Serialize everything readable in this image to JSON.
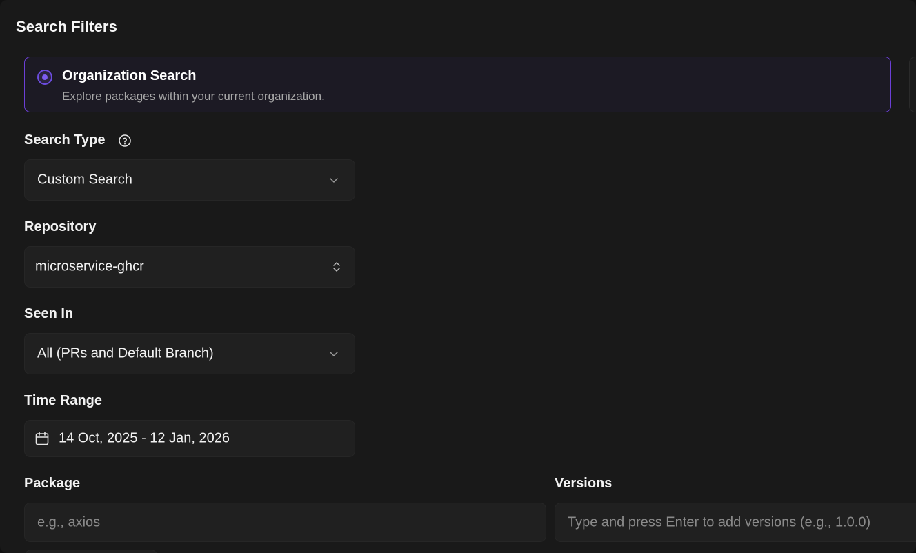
{
  "panel": {
    "title": "Search Filters"
  },
  "search_scope": {
    "selected": {
      "title": "Organization Search",
      "description": "Explore packages within your current organization."
    }
  },
  "search_type": {
    "label": "Search Type",
    "value": "Custom Search"
  },
  "repository": {
    "label": "Repository",
    "value": "microservice-ghcr"
  },
  "seen_in": {
    "label": "Seen In",
    "value": "All (PRs and Default Branch)"
  },
  "time_range": {
    "label": "Time Range",
    "value": "14 Oct, 2025 - 12 Jan, 2026"
  },
  "package": {
    "label": "Package",
    "placeholder": "e.g., axios"
  },
  "versions": {
    "label": "Versions",
    "placeholder": "Type and press Enter to add versions (e.g., 1.0.0)"
  },
  "colors": {
    "accent": "#6c3fd6",
    "background": "#191919",
    "field": "#202020"
  },
  "icons": {
    "help": "help-circle-icon",
    "chevron": "chevron-down-icon",
    "updown": "chevron-up-down-icon",
    "calendar": "calendar-icon"
  }
}
